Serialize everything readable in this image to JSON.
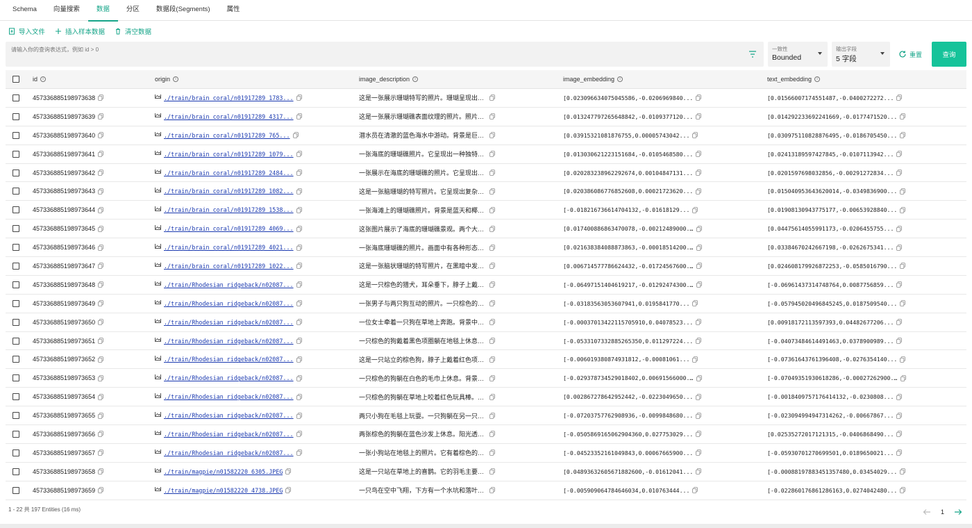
{
  "tabs": [
    "Schema",
    "向量搜索",
    "数据",
    "分区",
    "数据段(Segments)",
    "属性"
  ],
  "active_tab": 2,
  "actions": {
    "import": "导入文件",
    "insert_sample": "插入样本数据",
    "clear": "清空数据"
  },
  "query": {
    "placeholder": "请输入你的查询表达式，例如 id > 0",
    "consistency": {
      "label": "一致性",
      "value": "Bounded"
    },
    "output_fields": {
      "label": "输出字段",
      "value": "5 字段"
    },
    "reset": "重置",
    "submit": "查询"
  },
  "columns": {
    "id": "id",
    "origin": "origin",
    "image_description": "image_description",
    "image_embedding": "image_embedding",
    "text_embedding": "text_embedding"
  },
  "rows": [
    {
      "id": "457336885198973638",
      "origin": "./train/brain_coral/n01917289_1783...",
      "desc": "这是一张展示珊瑚特写的照片。珊瑚呈现出绿...",
      "img": "[0.023096634075045586,-0.0206969840...",
      "txt": "[0.01566007174551487,-0.0400272272..."
    },
    {
      "id": "457336885198973639",
      "origin": "./train/brain_coral/n01917289_4317...",
      "desc": "这是一张展示珊瑚礁表面纹理的照片。照片中...",
      "img": "[0.013247797265648842,-0.0109377120...",
      "txt": "[0.014292233692241669,-0.0177471520..."
    },
    {
      "id": "457336885198973640",
      "origin": "./train/brain_coral/n01917289_765...",
      "desc": "潜水员在清澈的蓝色海水中游动。背景是巨大...",
      "img": "[0.03915321081876755,0.00005743042...",
      "txt": "[0.030975110828876495,-0.0186705450..."
    },
    {
      "id": "457336885198973641",
      "origin": "./train/brain_coral/n01917289_1079...",
      "desc": "一张海底的珊瑚礁照片。它呈现出一种独特的...",
      "img": "[0.013030621223151684,-0.0105468580...",
      "txt": "[0.02413189597427845,-0.0107113942..."
    },
    {
      "id": "457336885198973642",
      "origin": "./train/brain_coral/n01917289_2484...",
      "desc": "一张展示在海底的珊瑚礁的照片。它呈现出黄...",
      "img": "[0.020283238962292674,0.00104847131...",
      "txt": "[0.0201597698032856,-0.00291272834..."
    },
    {
      "id": "457336885198973643",
      "origin": "./train/brain_coral/n01917289_1082...",
      "desc": "这是一张脑珊瑚的特写照片。它呈现出复杂的...",
      "img": "[0.020386086776852608,0.00021723620...",
      "txt": "[0.015040953643620014,-0.0349836900..."
    },
    {
      "id": "457336885198973644",
      "origin": "./train/brain_coral/n01917289_1538...",
      "desc": "一张海滩上的珊瑚礁照片。背景是蓝天和椰子...",
      "img": "[-0.018216736614704132,-0.01618129...",
      "txt": "[0.01908130943775177,-0.00653928840..."
    },
    {
      "id": "457336885198973645",
      "origin": "./train/brain_coral/n01917289_4069...",
      "desc": "这张图片展示了海底的珊瑚礁景观。两个大型...",
      "img": "[0.017400886863470078,-0.00212489000...",
      "txt": "[0.04475614055991173,-0.0206455755..."
    },
    {
      "id": "457336885198973646",
      "origin": "./train/brain_coral/n01917289_4021...",
      "desc": "一张海底珊瑚礁的照片。画面中有各种形态的...",
      "img": "[0.021638384088873863,-0.00018514200...",
      "txt": "[0.03384670242667198,-0.0262675341..."
    },
    {
      "id": "457336885198973647",
      "origin": "./train/brain_coral/n01917289_1022...",
      "desc": "这是一张脑状珊瑚的特写照片，在黑暗中发出...",
      "img": "[0.006714577786624432,-0.01724567600...",
      "txt": "[0.024608179926872253,-0.0585016790..."
    },
    {
      "id": "457336885198973648",
      "origin": "./train/Rhodesian_ridgeback/n02087...",
      "desc": "这是一只棕色的猎犬，耳朵垂下，脖子上戴着...",
      "img": "[-0.06497151404619217,-0.01292474300...",
      "txt": "[-0.06961437314748764,0.0087756859..."
    },
    {
      "id": "457336885198973649",
      "origin": "./train/Rhodesian_ridgeback/n02087...",
      "desc": "一张男子与两只狗互动的照片。一只棕色的狗...",
      "img": "[-0.03183563053607941,0.0195841770...",
      "txt": "[-0.057945020496845245,0.0187509540..."
    },
    {
      "id": "457336885198973650",
      "origin": "./train/Rhodesian_ridgeback/n02087...",
      "desc": "一位女士牵着一只狗在草地上奔跑。背景中有...",
      "img": "[-0.00037013422115705910,0.04078523...",
      "txt": "[0.00918172113597393,0.04482677206..."
    },
    {
      "id": "457336885198973651",
      "origin": "./train/Rhodesian_ridgeback/n02087...",
      "desc": "一只棕色的狗戴着黑色项圈躺在地毯上休息。...",
      "img": "[-0.0533107332885265350,0.011297224...",
      "txt": "[-0.04073484614491463,0.0378900989..."
    },
    {
      "id": "457336885198973652",
      "origin": "./train/Rhodesian_ridgeback/n02087...",
      "desc": "这是一只站立的棕色狗，脖子上戴着红色项圈...",
      "img": "[-0.006019380874931812,-0.00081061...",
      "txt": "[-0.07361643761396408,-0.0276354140..."
    },
    {
      "id": "457336885198973653",
      "origin": "./train/Rhodesian_ridgeback/n02087...",
      "desc": "一只棕色的狗躺在白色的毛巾上休息。背景是...",
      "img": "[-0.029378734529018402,0.00691566000...",
      "txt": "[-0.07049351930618286,-0.00027262900..."
    },
    {
      "id": "457336885198973654",
      "origin": "./train/Rhodesian_ridgeback/n02087...",
      "desc": "一只棕色的狗躺在草地上咬着红色玩具棒。背...",
      "img": "[0.002867278642952442,-0.0223049650...",
      "txt": "[-0.0018409757176414132,-0.0230808..."
    },
    {
      "id": "457336885198973655",
      "origin": "./train/Rhodesian_ridgeback/n02087...",
      "desc": "两只小狗在毛毯上玩耍。一只狗躺在另一只上...",
      "img": "[-0.07203757762908936,-0.0099848680...",
      "txt": "[-0.023094994947314262,-0.00667867..."
    },
    {
      "id": "457336885198973656",
      "origin": "./train/Rhodesian_ridgeback/n02087...",
      "desc": "两张棕色的狗躺在蓝色沙发上休息。阳光透过...",
      "img": "[-0.0505869165062904360,0.027753029...",
      "txt": "[0.02535272017121315,-0.0406868490..."
    },
    {
      "id": "457336885198973657",
      "origin": "./train/Rhodesian_ridgeback/n02087...",
      "desc": "一张小狗站在地毯上的照片。它有着棕色的毛...",
      "img": "[-0.04523352161049843,0.00067665900...",
      "txt": "[-0.05930701270699501,0.0189650021..."
    },
    {
      "id": "457336885198973658",
      "origin": "./train/magpie/n01582220_6305.JPEG",
      "desc": "这是一只站在草地上的喜鹊。它的羽毛主要是...",
      "img": "[0.04893632605671882600,-0.01612041...",
      "txt": "[-0.00088197883451357480,0.03454029..."
    },
    {
      "id": "457336885198973659",
      "origin": "./train/magpie/n01582220_4738.JPEG",
      "desc": "一只鸟在空中飞翔，下方有一个水坑和落叶。...",
      "img": "[-0.005909064784646034,0.010763444...",
      "txt": "[-0.022860176861286163,0.0274042480..."
    }
  ],
  "footer": "1 - 22  共 197 Entities (16 ms)",
  "page": "1"
}
